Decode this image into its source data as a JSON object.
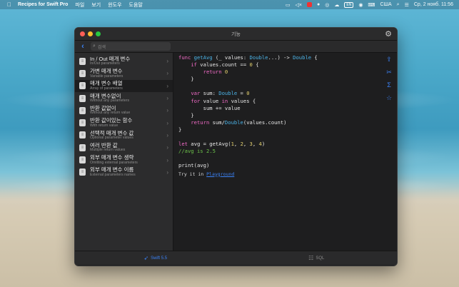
{
  "menubar": {
    "app_name": "Recipes for Swift Pro",
    "items": [
      "파일",
      "보기",
      "윈도우",
      "도움말"
    ],
    "input_badge": "EN",
    "input_source": "США",
    "datetime": "Ср, 2 нояб.  11:56"
  },
  "window": {
    "title": "기능",
    "search_placeholder": "검색"
  },
  "sidebar": {
    "items": [
      {
        "title": "In / Out 매개 변수",
        "subtitle": "In/Out parameters"
      },
      {
        "title": "가변 매개 변수",
        "subtitle": "Variable parameters"
      },
      {
        "title": "매개 변수 배열",
        "subtitle": "Array of parameters"
      },
      {
        "title": "매개 변수없이",
        "subtitle": "Without any parameters"
      },
      {
        "title": "반환 값없이",
        "subtitle": "Without any return value"
      },
      {
        "title": "반환 값이있는 함수",
        "subtitle": "With return value"
      },
      {
        "title": "선택적 매개 변수 값",
        "subtitle": "Optional parameter values"
      },
      {
        "title": "여러 반환 값",
        "subtitle": "Multiple return values"
      },
      {
        "title": "외부 매개 변수 생략",
        "subtitle": "Omitting external parameters"
      },
      {
        "title": "외부 매개 변수 이름",
        "subtitle": "External parameters names"
      }
    ],
    "selected_index": 2
  },
  "editor": {
    "code_lines": [
      "func getAvg (_ values: Double...) -> Double {",
      "    if values.count == 0 {",
      "        return 0",
      "    }",
      "",
      "    var sum: Double = 0",
      "    for value in values {",
      "        sum += value",
      "    }",
      "    return sum/Double(values.count)",
      "}",
      "",
      "let avg = getAvg(1, 2, 3, 4)",
      "//avg is 2.5",
      "",
      "print(avg)"
    ],
    "try_prefix": "Try it in ",
    "try_link": "Playground"
  },
  "tabs": {
    "swift_label": "Swift 5.5",
    "sql_label": "SQL"
  },
  "colors": {
    "accent": "#3b82f6",
    "keyword": "#f06bc6",
    "type": "#4cb4e8",
    "number": "#e5d26f",
    "comment": "#6cc24a"
  }
}
